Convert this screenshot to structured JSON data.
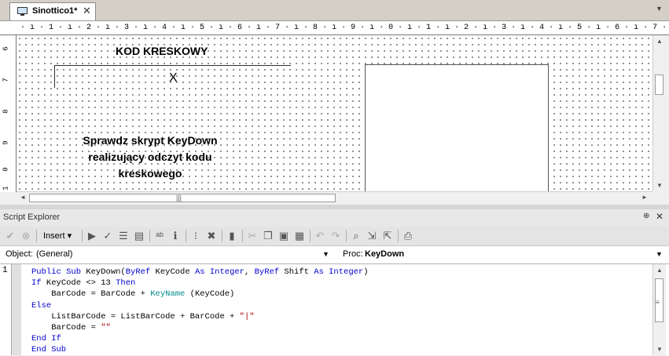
{
  "tab": {
    "title": "Sinottico1*",
    "close": "✕",
    "menu_arrow": "▼"
  },
  "ruler": {
    "top": "· ı · 1 · ı · 2 · ı · 3 · ı · 4 · ı · 5 · ı · 6 · ı · 7 · ı · 8 · ı · 9 · ı · 0 · ı · 1 · ı · 2 · ı · 3 · ı · 4 · ı · 5 · ı · 6 · ı · 7 · ı · 8 · ı · 9 · ı · 0 · ı · 1 · ı · 2",
    "left": [
      "6",
      "7",
      "8",
      "9",
      "0",
      "1"
    ]
  },
  "canvas": {
    "title": "KOD KRESKOWY",
    "barcode_value": "X",
    "hint": "Sprawdz skrypt KeyDown realizujący odczyt kodu kreskowego"
  },
  "scroll": {
    "up": "▲",
    "down": "▼",
    "left": "◄",
    "right": "►",
    "grip_h": "|||",
    "grip_v": "≡"
  },
  "script_explorer": {
    "title": "Script Explorer",
    "pin": "⊕",
    "close": "✕",
    "insert_label": "Insert ▾",
    "object_label": "Object:",
    "object_value": "(General)",
    "proc_label": "Proc:",
    "proc_value": "KeyDown",
    "combo_arrow": "▼",
    "line_number": "1"
  },
  "toolbar_icons": [
    "check-icon",
    "cancel-icon",
    "insert-menu",
    "run-icon",
    "syntax-check-icon",
    "list-icon",
    "form-icon",
    "spell-icon",
    "info-icon",
    "breakpoint-icon",
    "clear-breakpoints-icon",
    "delete-icon",
    "cut-icon",
    "copy-icon",
    "paste-icon",
    "paste-special-icon",
    "undo-icon",
    "redo-icon",
    "find-icon",
    "find-next-icon",
    "find-prev-icon",
    "print-icon"
  ]
}
